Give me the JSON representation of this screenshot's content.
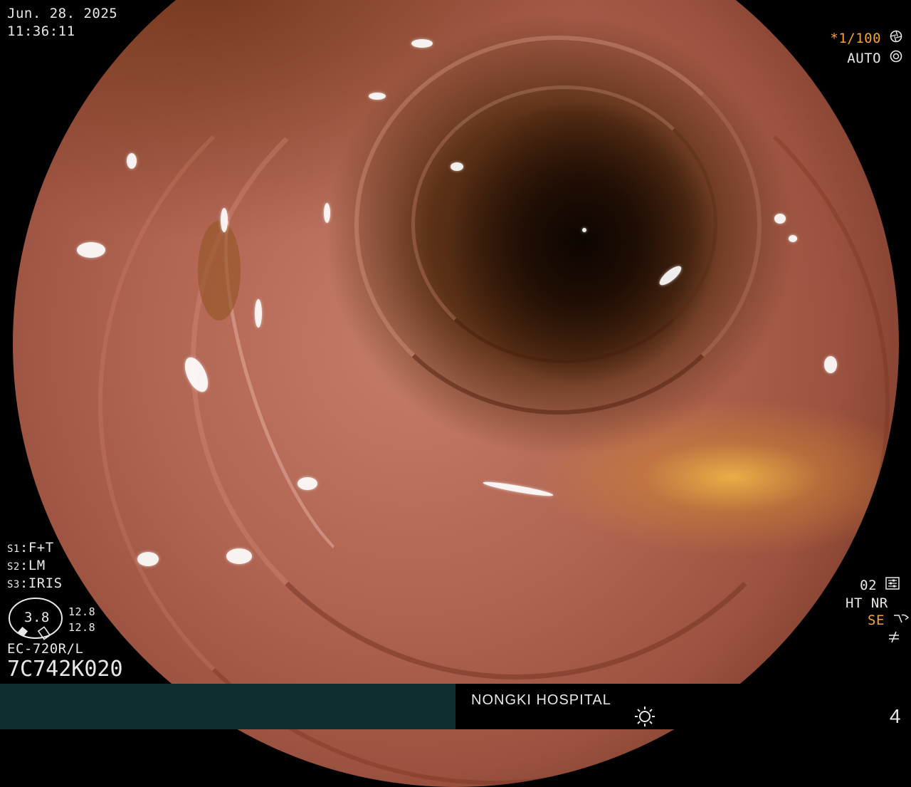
{
  "datetime": {
    "date": "Jun. 28. 2025",
    "time": "11:36:11"
  },
  "top_right": {
    "shutter": "*1/100",
    "shutter_icon": "shutter-icon",
    "iris": "AUTO",
    "iris_icon": "iris-icon",
    "accent_color": "#f4a23a"
  },
  "switches": [
    {
      "key": "S1",
      "value": "F+T"
    },
    {
      "key": "S2",
      "value": "LM"
    },
    {
      "key": "S3",
      "value": "IRIS"
    }
  ],
  "gauge": {
    "center_value": "3.8",
    "upper_value": "12.8",
    "lower_value": "12.8"
  },
  "scope": {
    "model": "EC-720R/L",
    "serial": "7C742K020"
  },
  "bottom_right": {
    "preset": "02",
    "preset_icon": "settings-icon",
    "ht_nr": "HT NR",
    "se": "SE",
    "se_icon": "enhance-icon",
    "extra_icon": "not-equal-icon"
  },
  "footer": {
    "hospital": "NONGKI HOSPITAL",
    "light_icon": "light-icon",
    "page_number": "4",
    "bar_color": "#0f2f2f"
  }
}
